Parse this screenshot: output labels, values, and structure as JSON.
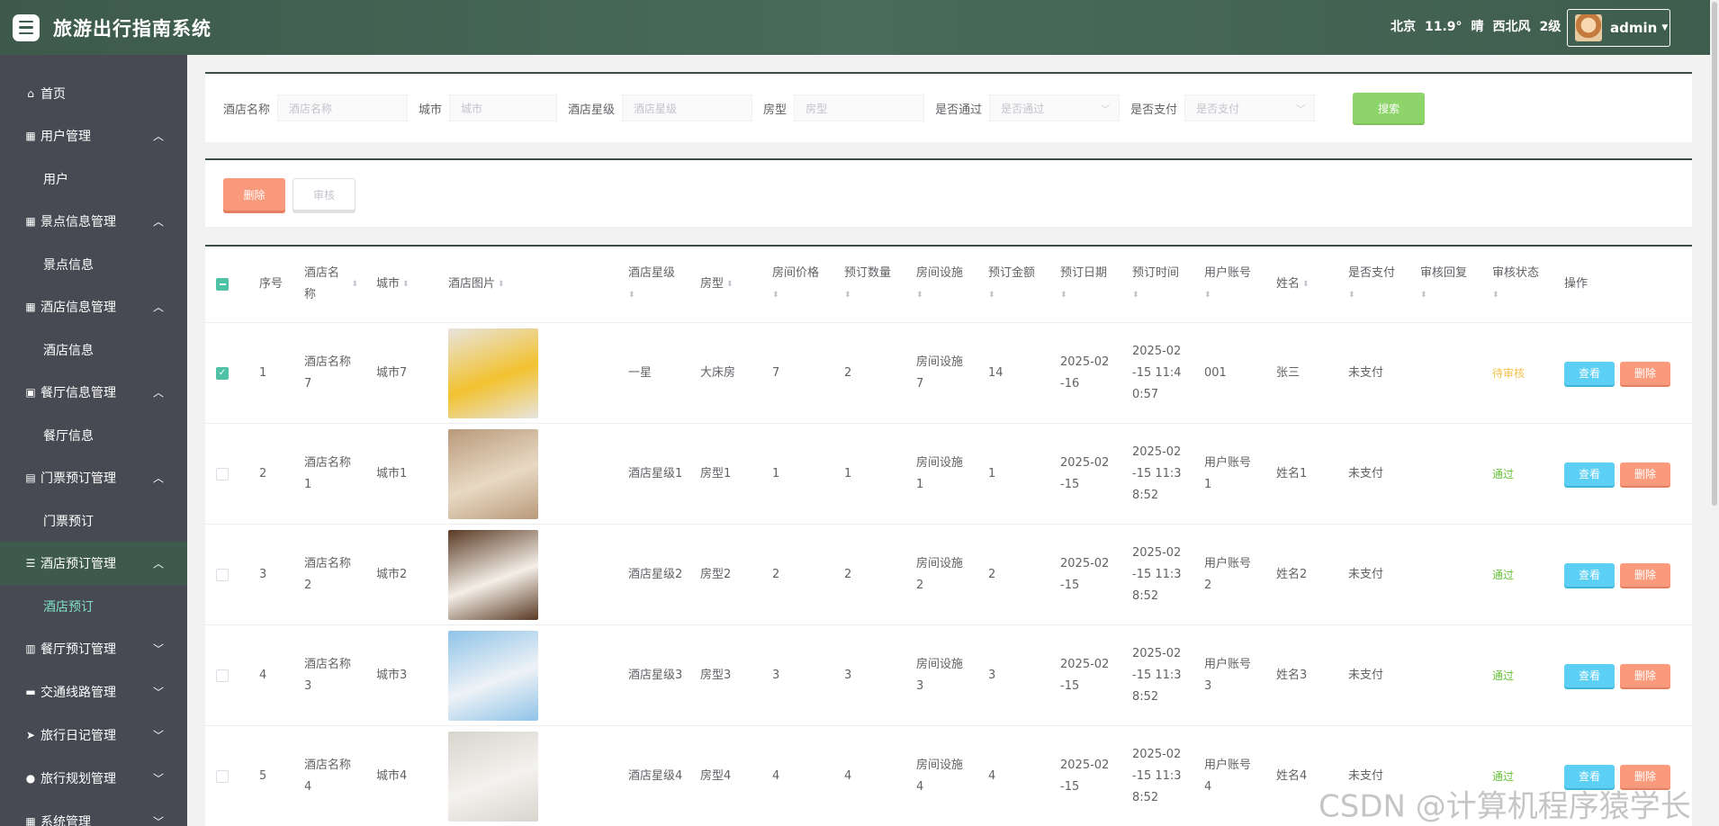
{
  "header": {
    "title": "旅游出行指南系统",
    "weather": {
      "city": "北京",
      "temp": "11.9°",
      "condition": "晴",
      "wind": "西北风",
      "level": "2级"
    },
    "user": "admin"
  },
  "sidebar": {
    "home": "首页",
    "groups": [
      {
        "label": "用户管理",
        "icon": "grid-icon",
        "sub": "用户",
        "expanded": true
      },
      {
        "label": "景点信息管理",
        "icon": "grid-icon",
        "sub": "景点信息",
        "expanded": true
      },
      {
        "label": "酒店信息管理",
        "icon": "grid-icon",
        "sub": "酒店信息",
        "expanded": true
      },
      {
        "label": "餐厅信息管理",
        "icon": "clipboard-icon",
        "sub": "餐厅信息",
        "expanded": true
      },
      {
        "label": "门票预订管理",
        "icon": "ticket-icon",
        "sub": "门票预订",
        "expanded": true
      },
      {
        "label": "酒店预订管理",
        "icon": "list-icon",
        "sub": "酒店预订",
        "expanded": true,
        "active": true
      },
      {
        "label": "餐厅预订管理",
        "icon": "bar-chart-icon",
        "expanded": false
      },
      {
        "label": "交通线路管理",
        "icon": "bus-icon",
        "expanded": false
      },
      {
        "label": "旅行日记管理",
        "icon": "send-icon",
        "expanded": false
      },
      {
        "label": "旅行规划管理",
        "icon": "location-icon",
        "expanded": false
      },
      {
        "label": "系统管理",
        "icon": "grid-icon",
        "expanded": false
      }
    ]
  },
  "search": {
    "fields": [
      {
        "label": "酒店名称",
        "placeholder": "酒店名称"
      },
      {
        "label": "城市",
        "placeholder": "城市"
      },
      {
        "label": "酒店星级",
        "placeholder": "酒店星级"
      },
      {
        "label": "房型",
        "placeholder": "房型"
      },
      {
        "label": "是否通过",
        "placeholder": "是否通过"
      },
      {
        "label": "是否支付",
        "placeholder": "是否支付"
      }
    ],
    "button": "搜索"
  },
  "actions": {
    "delete": "删除",
    "audit": "审核"
  },
  "table": {
    "headers": {
      "index": "序号",
      "hotel_name": "酒店名称",
      "city": "城市",
      "image": "酒店图片",
      "star": "酒店星级",
      "room_type": "房型",
      "price": "房间价格",
      "quantity": "预订数量",
      "facility": "房间设施",
      "amount": "预订金额",
      "date": "预订日期",
      "time": "预订时间",
      "account": "用户账号",
      "name": "姓名",
      "paid": "是否支付",
      "reply": "审核回复",
      "status": "审核状态",
      "ops": "操作"
    },
    "rows": [
      {
        "index": "1",
        "hotel_name": "酒店名称7",
        "city": "城市7",
        "star": "一星",
        "room_type": "大床房",
        "price": "7",
        "quantity": "2",
        "facility": "房间设施7",
        "amount": "14",
        "date": "2025-02-16",
        "time": "2025-02-15 11:40:57",
        "account": "001",
        "name": "张三",
        "paid": "未支付",
        "reply": "",
        "status": "待审核",
        "checked": true,
        "img_colors": [
          "#e8e4de",
          "#f2c230"
        ]
      },
      {
        "index": "2",
        "hotel_name": "酒店名称1",
        "city": "城市1",
        "star": "酒店星级1",
        "room_type": "房型1",
        "price": "1",
        "quantity": "1",
        "facility": "房间设施1",
        "amount": "1",
        "date": "2025-02-15",
        "time": "2025-02-15 11:38:52",
        "account": "用户账号1",
        "name": "姓名1",
        "paid": "未支付",
        "reply": "",
        "status": "通过",
        "checked": false,
        "img_colors": [
          "#b99a7a",
          "#e8d9c4"
        ]
      },
      {
        "index": "3",
        "hotel_name": "酒店名称2",
        "city": "城市2",
        "star": "酒店星级2",
        "room_type": "房型2",
        "price": "2",
        "quantity": "2",
        "facility": "房间设施2",
        "amount": "2",
        "date": "2025-02-15",
        "time": "2025-02-15 11:38:52",
        "account": "用户账号2",
        "name": "姓名2",
        "paid": "未支付",
        "reply": "",
        "status": "通过",
        "checked": false,
        "img_colors": [
          "#5a3a24",
          "#f4efe8"
        ]
      },
      {
        "index": "4",
        "hotel_name": "酒店名称3",
        "city": "城市3",
        "star": "酒店星级3",
        "room_type": "房型3",
        "price": "3",
        "quantity": "3",
        "facility": "房间设施3",
        "amount": "3",
        "date": "2025-02-15",
        "time": "2025-02-15 11:38:52",
        "account": "用户账号3",
        "name": "姓名3",
        "paid": "未支付",
        "reply": "",
        "status": "通过",
        "checked": false,
        "img_colors": [
          "#8fc3e8",
          "#eef2f6"
        ]
      },
      {
        "index": "5",
        "hotel_name": "酒店名称4",
        "city": "城市4",
        "star": "酒店星级4",
        "room_type": "房型4",
        "price": "4",
        "quantity": "4",
        "facility": "房间设施4",
        "amount": "4",
        "date": "2025-02-15",
        "time": "2025-02-15 11:38:52",
        "account": "用户账号4",
        "name": "姓名4",
        "paid": "未支付",
        "reply": "",
        "status": "通过",
        "checked": false,
        "img_colors": [
          "#d8d4ce",
          "#f4f2ee"
        ]
      }
    ],
    "view_label": "查看",
    "delete_label": "删除"
  },
  "watermark": "CSDN @计算机程序猿学长"
}
